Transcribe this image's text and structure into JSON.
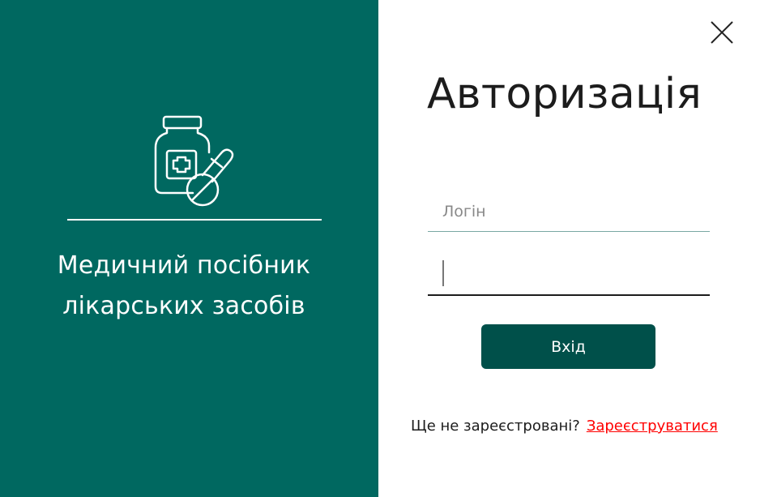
{
  "brand": {
    "title_line1": "Медичний посібник",
    "title_line2": "лікарських засобів",
    "logo_icon": "medicine-bottle-pills-icon",
    "panel_color": "#006860"
  },
  "form": {
    "title": "Авторизація",
    "login_placeholder": "Логін",
    "login_value": "",
    "password_value": "",
    "submit_label": "Вхід",
    "button_color": "#00504a"
  },
  "register": {
    "prompt": "Ще не зареєстровані?",
    "link_label": "Зареєструватися",
    "link_color": "#ff0000"
  },
  "window": {
    "close_icon": "close-icon"
  }
}
